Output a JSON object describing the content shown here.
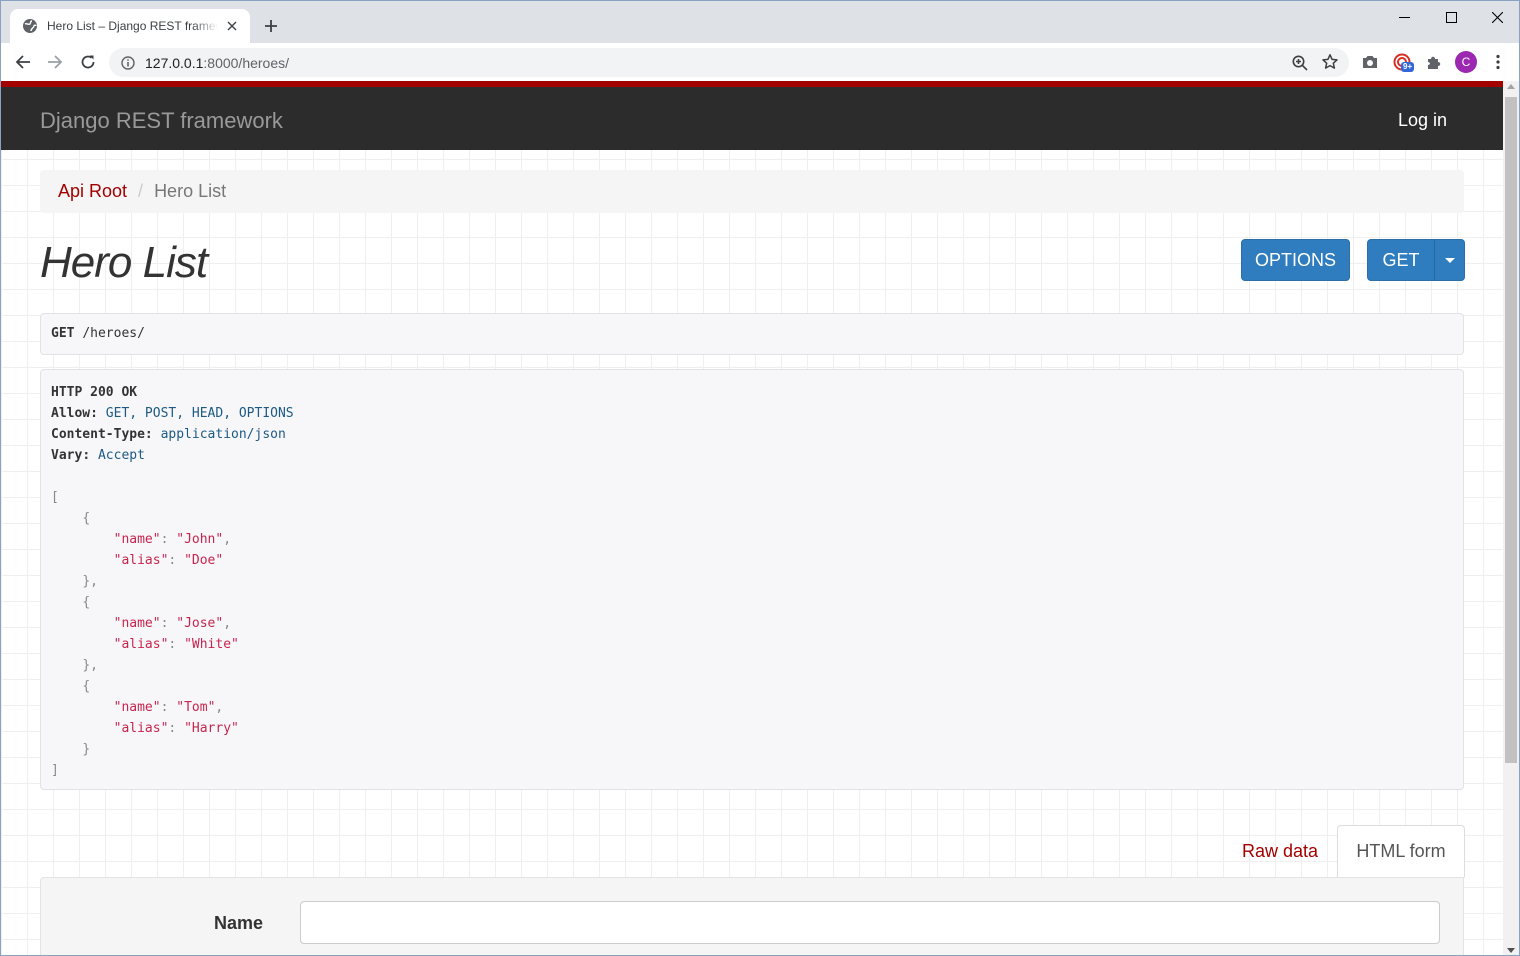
{
  "browser": {
    "tab_title": "Hero List – Django REST framework",
    "url_host": "127.0.0.1",
    "url_rest": ":8000/heroes/",
    "profile_initial": "C",
    "ext_badge": "9+"
  },
  "navbar": {
    "brand": "Django REST framework",
    "login": "Log in"
  },
  "breadcrumb": {
    "root": "Api Root",
    "sep": "/",
    "current": "Hero List"
  },
  "page": {
    "title": "Hero List",
    "options_button": "OPTIONS",
    "get_button": "GET"
  },
  "request": {
    "method": "GET",
    "path": "/heroes/"
  },
  "response": {
    "status": "HTTP 200 OK",
    "headers": [
      {
        "key": "Allow",
        "value": "GET, POST, HEAD, OPTIONS"
      },
      {
        "key": "Content-Type",
        "value": "application/json"
      },
      {
        "key": "Vary",
        "value": "Accept"
      }
    ],
    "body": [
      {
        "name": "John",
        "alias": "Doe"
      },
      {
        "name": "Jose",
        "alias": "White"
      },
      {
        "name": "Tom",
        "alias": "Harry"
      }
    ]
  },
  "form": {
    "tab_raw": "Raw data",
    "tab_html": "HTML form",
    "name_label": "Name",
    "name_value": ""
  },
  "colors": {
    "accent": "#a30000",
    "navbar": "#2c2c2c",
    "button": "#2f7dbe"
  }
}
